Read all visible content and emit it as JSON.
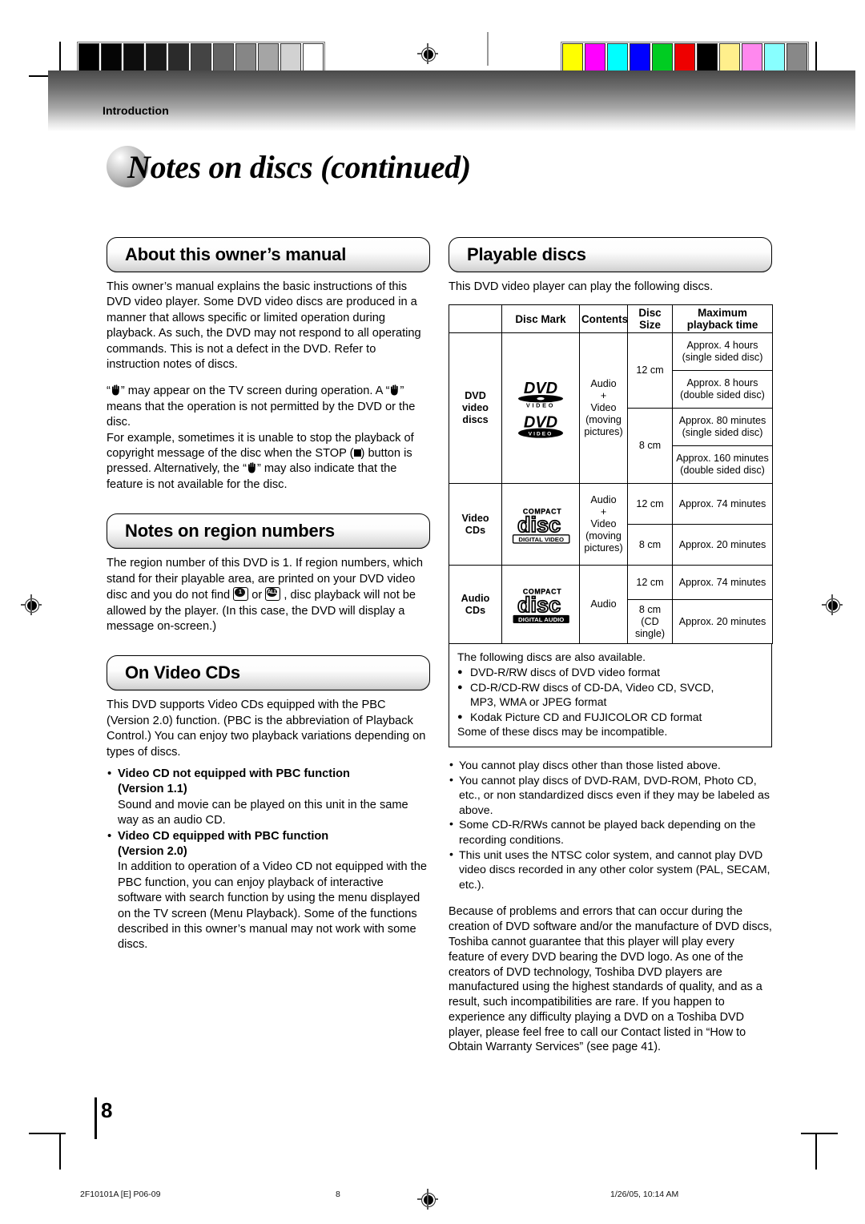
{
  "header": {
    "section_label": "Introduction",
    "title": "Notes on discs (continued)"
  },
  "calibration": {
    "gray_steps": [
      "#000000",
      "#050505",
      "#0d0d0d",
      "#191919",
      "#2b2b2b",
      "#444444",
      "#636363",
      "#868686",
      "#a5a5a5",
      "#d2d2d2",
      "#ffffff"
    ],
    "color_steps": [
      "#ffff00",
      "#ff00ff",
      "#00ffff",
      "#0000ff",
      "#00cc22",
      "#ee0000",
      "#000000",
      "#ffef8c",
      "#ff88ee",
      "#88ffff",
      "#888888"
    ]
  },
  "left": {
    "s1": {
      "heading": "About this owner’s manual",
      "p1": "This owner’s manual explains the basic instructions of this DVD video player. Some DVD video discs are produced in a manner that allows specific or limited operation during playback. As such, the DVD may not respond to all operating commands. This is not a defect in the DVD. Refer to instruction notes of discs.",
      "p2a": "“",
      "p2b": "” may appear on the TV screen during operation. A “",
      "p2c": "” means that the operation is not permitted by the DVD or the disc.",
      "p3a": "For example, sometimes it is unable to stop the playback of copyright message of the disc when the STOP (",
      "p3b": ") button is pressed. Alternatively, the “",
      "p3c": "” may also indicate that the feature is not available for the disc."
    },
    "s2": {
      "heading": "Notes on region numbers",
      "p1a": "The region number of this DVD is 1. If region numbers, which stand for their playable area, are printed on your DVD video disc and you do not find ",
      "p1_icon1": "1",
      "p1b": " or ",
      "p1_icon2": "ALL",
      "p1c": " , disc playback will not be allowed by the player. (In this case, the DVD will display a message on-screen.)"
    },
    "s3": {
      "heading": "On Video CDs",
      "p1": "This DVD supports Video CDs equipped with the PBC (Version 2.0) function. (PBC is the abbreviation of Playback Control.) You can enjoy two playback variations depending on types of discs.",
      "b1_title": "Video CD not equipped with PBC function",
      "b1_ver": "(Version 1.1)",
      "b1_text": "Sound and movie can be played on this unit in the same way as an audio CD.",
      "b2_title": "Video CD equipped with PBC function",
      "b2_ver": "(Version 2.0)",
      "b2_text": "In addition to operation of a Video CD not equipped with the PBC function, you can enjoy playback of interactive software with search function by using the menu displayed on the TV screen (Menu Playback). Some of the functions described in this owner’s manual may not work with some discs."
    }
  },
  "right": {
    "heading": "Playable discs",
    "intro": "This DVD video player can play the following discs.",
    "table": {
      "headers": [
        "",
        "Disc Mark",
        "Contents",
        "Disc Size",
        "Maximum playback time"
      ],
      "header_disc_size_l1": "Disc",
      "header_disc_size_l2": "Size",
      "header_max_l1": "Maximum",
      "header_max_l2": "playback time",
      "rows": [
        {
          "category": "DVD video discs",
          "category_lines": [
            "DVD",
            "video",
            "discs"
          ],
          "mark": "dvd-video-logo",
          "contents_lines": [
            "Audio",
            "+",
            "Video",
            "(moving",
            "pictures)"
          ],
          "sizes": [
            {
              "size": "12 cm",
              "times": [
                "Approx. 4 hours",
                "(single sided disc)",
                "Approx. 8 hours",
                "(double sided disc)"
              ]
            },
            {
              "size": "8 cm",
              "times": [
                "Approx. 80 minutes",
                "(single sided disc)",
                "Approx. 160 minutes",
                "(double sided disc)"
              ]
            }
          ]
        },
        {
          "category": "Video CDs",
          "category_lines": [
            "Video",
            "CDs"
          ],
          "mark": "compact-disc-digital-video-logo",
          "mark_top": "COMPACT",
          "mark_word": "disc",
          "mark_bottom": "DIGITAL VIDEO",
          "contents_lines": [
            "Audio",
            "+",
            "Video",
            "(moving",
            "pictures)"
          ],
          "sizes": [
            {
              "size": "12 cm",
              "times": [
                "Approx. 74 minutes"
              ]
            },
            {
              "size": "8 cm",
              "times": [
                "Approx. 20 minutes"
              ]
            }
          ]
        },
        {
          "category": "Audio CDs",
          "category_lines": [
            "Audio",
            "CDs"
          ],
          "mark": "compact-disc-digital-audio-logo",
          "mark_top": "COMPACT",
          "mark_word": "disc",
          "mark_bottom": "DIGITAL AUDIO",
          "contents_lines": [
            "Audio"
          ],
          "sizes": [
            {
              "size": "12 cm",
              "times": [
                "Approx. 74 minutes"
              ]
            },
            {
              "size": "8 cm (CD single)",
              "size_lines": [
                "8 cm",
                "(CD",
                "single)"
              ],
              "times": [
                "Approx. 20 minutes"
              ]
            }
          ]
        }
      ]
    },
    "available": {
      "intro": "The following discs are also available.",
      "items": [
        "DVD-R/RW discs of DVD video format",
        "CD-R/CD-RW discs of CD-DA, Video CD, SVCD,",
        "Kodak Picture CD and FUJICOLOR CD format"
      ],
      "item2_cont": "MP3, WMA or JPEG format",
      "outro": "Some of these discs may be incompatible."
    },
    "notes": [
      "You cannot play discs other than those listed above.",
      "You cannot play discs of DVD-RAM, DVD-ROM, Photo CD, etc., or non standardized discs even if they may be labeled as above.",
      "Some CD-R/RWs cannot be played back depending on the recording conditions.",
      "This unit uses the NTSC color system, and cannot play DVD video discs recorded in any other color system (PAL, SECAM, etc.)."
    ],
    "closing": "Because of problems and errors that can occur during the creation of DVD software and/or the manufacture of DVD discs, Toshiba cannot guarantee that this player will play every feature of every DVD bearing the DVD logo.  As one of the creators of DVD technology, Toshiba DVD players are manufactured using the highest standards of quality, and as a result, such incompatibilities are rare.  If you happen to experience any difficulty playing a DVD on a Toshiba DVD player, please feel free to call our Contact listed in “How to Obtain Warranty Services” (see page 41)."
  },
  "page_number": "8",
  "footer": {
    "file_id": "2F10101A [E] P06-09",
    "page": "8",
    "timestamp": "1/26/05, 10:14 AM"
  }
}
